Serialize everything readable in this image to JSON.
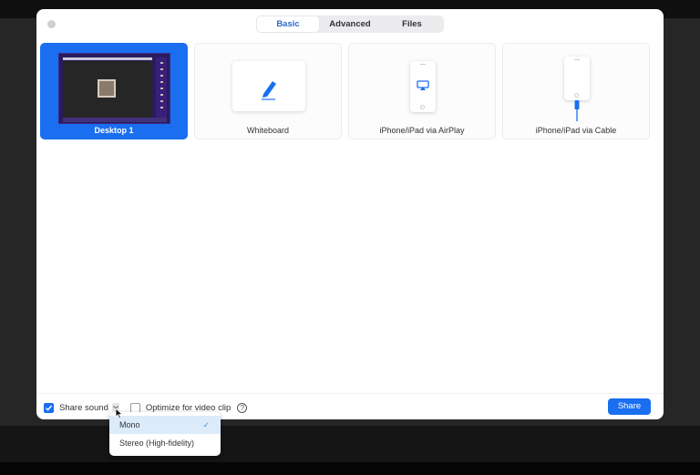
{
  "tabs": [
    {
      "label": "Basic",
      "active": true
    },
    {
      "label": "Advanced",
      "active": false
    },
    {
      "label": "Files",
      "active": false
    }
  ],
  "share_options": [
    {
      "label": "Desktop 1",
      "icon": "desktop-thumbnail",
      "selected": true
    },
    {
      "label": "Whiteboard",
      "icon": "pencil-icon",
      "selected": false
    },
    {
      "label": "iPhone/iPad via AirPlay",
      "icon": "airplay-icon",
      "selected": false
    },
    {
      "label": "iPhone/iPad via Cable",
      "icon": "cable-icon",
      "selected": false
    }
  ],
  "footer": {
    "share_sound_label": "Share sound",
    "share_sound_checked": true,
    "optimize_label": "Optimize for video clip",
    "optimize_checked": false,
    "help_glyph": "?",
    "share_button_label": "Share"
  },
  "sound_menu": {
    "items": [
      {
        "label": "Mono",
        "checked": true
      },
      {
        "label": "Stereo (High-fidelity)",
        "checked": false
      }
    ],
    "check_glyph": "✓"
  },
  "colors": {
    "accent": "#1a6ff0",
    "tab_active_text": "#2a6cc9",
    "menu_highlight": "#dcebf9"
  }
}
